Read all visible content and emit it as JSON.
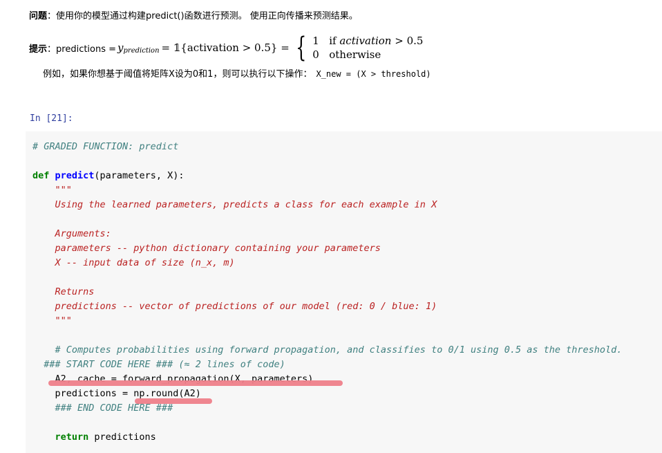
{
  "markdown": {
    "question_label": "问题",
    "question_text": "：使用你的模型通过构建predict()函数进行预测。 使用正向传播来预测结果。",
    "hint_label": "提示",
    "hint_text": "：predictions =",
    "formula": {
      "y": "y",
      "y_sub": "prediction",
      "eq1": " = 𝟙{activation > 0.5} =",
      "case1_val": "1",
      "case1_cond_if": "if ",
      "case1_cond_var": "activation",
      "case1_cond_rest": " > 0.5",
      "case2_val": "0",
      "case2_cond": "otherwise"
    },
    "example_text": "例如，如果你想基于阈值将矩阵X设为0和1，则可以执行以下操作：",
    "example_code": "X_new = (X > threshold)"
  },
  "cell": {
    "prompt": "In [21]:",
    "lines": [
      {
        "cls": "cm",
        "text": "# GRADED FUNCTION: predict"
      },
      {
        "cls": "pl",
        "text": ""
      },
      {
        "parts": [
          {
            "cls": "kw",
            "text": "def "
          },
          {
            "cls": "fn",
            "text": "predict"
          },
          {
            "cls": "pl",
            "text": "(parameters, X):"
          }
        ]
      },
      {
        "cls": "doc",
        "text": "    \"\"\""
      },
      {
        "cls": "doc",
        "text": "    Using the learned parameters, predicts a class for each example in X"
      },
      {
        "cls": "pl",
        "text": ""
      },
      {
        "cls": "doc",
        "text": "    Arguments:"
      },
      {
        "cls": "doc",
        "text": "    parameters -- python dictionary containing your parameters"
      },
      {
        "cls": "doc",
        "text": "    X -- input data of size (n_x, m)"
      },
      {
        "cls": "pl",
        "text": ""
      },
      {
        "cls": "doc",
        "text": "    Returns"
      },
      {
        "cls": "doc",
        "text": "    predictions -- vector of predictions of our model (red: 0 / blue: 1)"
      },
      {
        "cls": "doc",
        "text": "    \"\"\""
      },
      {
        "cls": "pl",
        "text": ""
      },
      {
        "cls": "cm",
        "text": "    # Computes probabilities using forward propagation, and classifies to 0/1 using 0.5 as the threshold."
      },
      {
        "cls": "cm",
        "text": "  ### START CODE HERE ### (≈ 2 lines of code)"
      },
      {
        "cls": "pl",
        "text": "    A2, cache = forward_propagation(X, parameters)"
      },
      {
        "cls": "pl",
        "text": "    predictions = np.round(A2)"
      },
      {
        "cls": "cm",
        "text": "    ### END CODE HERE ###"
      },
      {
        "cls": "pl",
        "text": ""
      },
      {
        "parts": [
          {
            "cls": "kw",
            "text": "    return"
          },
          {
            "cls": "pl",
            "text": " predictions"
          }
        ]
      }
    ]
  },
  "colors": {
    "highlight": "#ee7f8a",
    "cell_bg": "#f7f7f7",
    "prompt": "#303f9f"
  }
}
